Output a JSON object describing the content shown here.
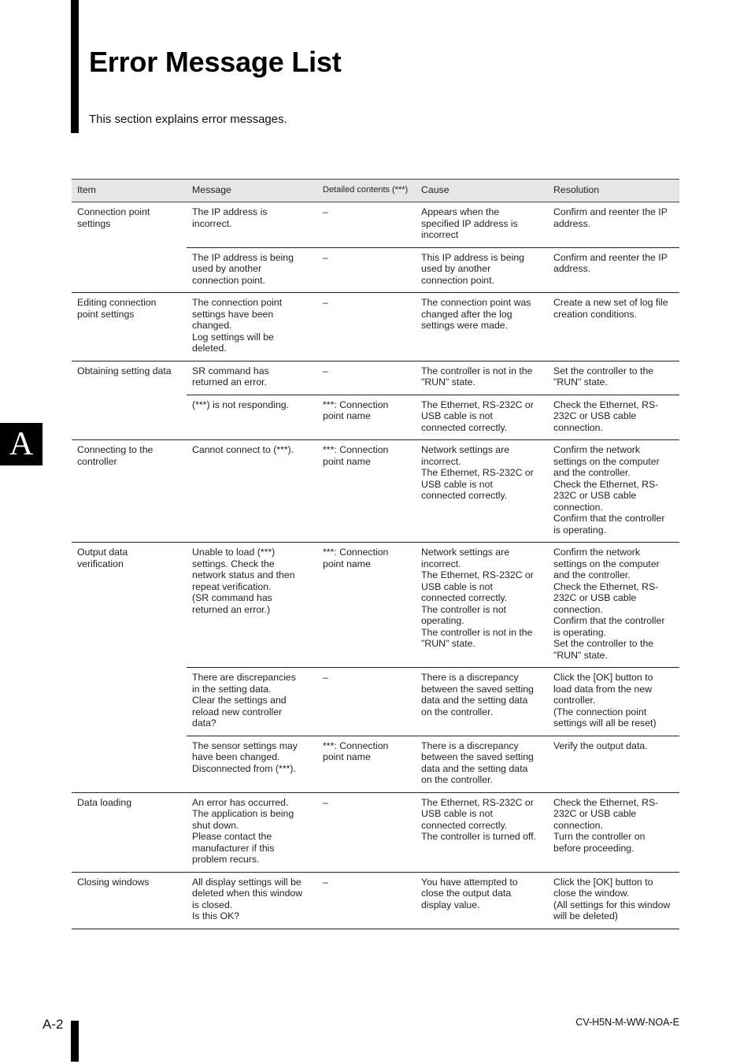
{
  "page": {
    "title": "Error Message List",
    "intro": "This section explains error messages.",
    "side_tab": "A",
    "page_number": "A-2",
    "doc_code": "CV-H5N-M-WW-NOA-E"
  },
  "table": {
    "headers": [
      "Item",
      "Message",
      "Detailed contents (***)",
      "Cause",
      "Resolution"
    ],
    "groups": [
      {
        "item": "Connection point\nsettings",
        "rows": [
          {
            "message": "The IP address is\nincorrect.",
            "detail": "–",
            "cause": "Appears when the\nspecified IP address is\nincorrect",
            "resolution": "Confirm and reenter the IP\naddress."
          },
          {
            "message": "The IP address is being\nused by another\nconnection point.",
            "detail": "–",
            "cause": "This IP address is being\nused by another\nconnection point.",
            "resolution": "Confirm and reenter the IP\naddress."
          }
        ]
      },
      {
        "item": "Editing connection\npoint settings",
        "rows": [
          {
            "message": "The connection point\nsettings have been\nchanged.\nLog settings will be\ndeleted.",
            "detail": "–",
            "cause": "The connection point was\nchanged after the log\nsettings were made.",
            "resolution": "Create a new set of log file\ncreation conditions."
          }
        ]
      },
      {
        "item": "Obtaining setting data",
        "rows": [
          {
            "message": "SR command has\nreturned an error.",
            "detail": "–",
            "cause": "The controller is not in the\n\"RUN\" state.",
            "resolution": "Set the controller to the\n\"RUN\" state."
          },
          {
            "message": "(***) is not responding.",
            "detail": "***: Connection\npoint name",
            "cause": "The Ethernet, RS-232C or\nUSB cable is not\nconnected correctly.",
            "resolution": "Check the Ethernet, RS-\n232C or USB cable\nconnection."
          }
        ]
      },
      {
        "item": "Connecting to the\ncontroller",
        "rows": [
          {
            "message": "Cannot connect to (***).",
            "detail": "***: Connection\npoint name",
            "cause": "Network settings are\nincorrect.\nThe Ethernet, RS-232C or\nUSB cable is not\nconnected correctly.",
            "resolution": "Confirm the network\nsettings on the computer\nand the controller.\nCheck the Ethernet, RS-\n232C or USB cable\nconnection.\nConfirm that the controller\nis operating."
          }
        ]
      },
      {
        "item": "Output data\nverification",
        "rows": [
          {
            "message": "Unable to load (***)\nsettings. Check the\nnetwork status and then\nrepeat verification.\n(SR command has\nreturned an error.)",
            "detail": "***: Connection\npoint name",
            "cause": "Network settings are\nincorrect.\nThe Ethernet, RS-232C or\nUSB cable is not\nconnected correctly.\nThe controller is not\noperating.\nThe controller is not in the\n\"RUN\" state.",
            "resolution": "Confirm the network\nsettings on the computer\nand the controller.\nCheck the Ethernet, RS-\n232C or USB cable\nconnection.\nConfirm that the controller\nis operating.\nSet the controller to the\n\"RUN\" state."
          },
          {
            "message": "There are discrepancies\nin the setting data.\nClear the settings and\nreload new controller\ndata?",
            "detail": "–",
            "cause": "There is a discrepancy\nbetween the saved setting\ndata and the setting data\non the controller.",
            "resolution": "Click the [OK] button to\nload data from the new\ncontroller.\n(The connection point\nsettings will all be reset)"
          },
          {
            "message": "The sensor settings may\nhave been changed.\nDisconnected from (***).",
            "detail": "***: Connection\npoint name",
            "cause": "There is a discrepancy\nbetween the saved setting\ndata and the setting data\non the controller.",
            "resolution": "Verify the output data."
          }
        ]
      },
      {
        "item": "Data loading",
        "rows": [
          {
            "message": "An error has occurred.\nThe application is being\nshut down.\nPlease contact the\nmanufacturer if this\nproblem recurs.",
            "detail": "–",
            "cause": "The Ethernet, RS-232C or\nUSB cable is not\nconnected correctly.\nThe controller is turned off.",
            "resolution": "Check the Ethernet, RS-\n232C or USB cable\nconnection.\nTurn the controller on\nbefore proceeding."
          }
        ]
      },
      {
        "item": "Closing windows",
        "rows": [
          {
            "message": "All display settings will be\ndeleted when this window\nis closed.\nIs this OK?",
            "detail": "–",
            "cause": "You have attempted to\nclose the output data\ndisplay value.",
            "resolution": "Click the [OK] button to\nclose the window.\n(All settings for this window\nwill be deleted)"
          }
        ]
      }
    ]
  }
}
